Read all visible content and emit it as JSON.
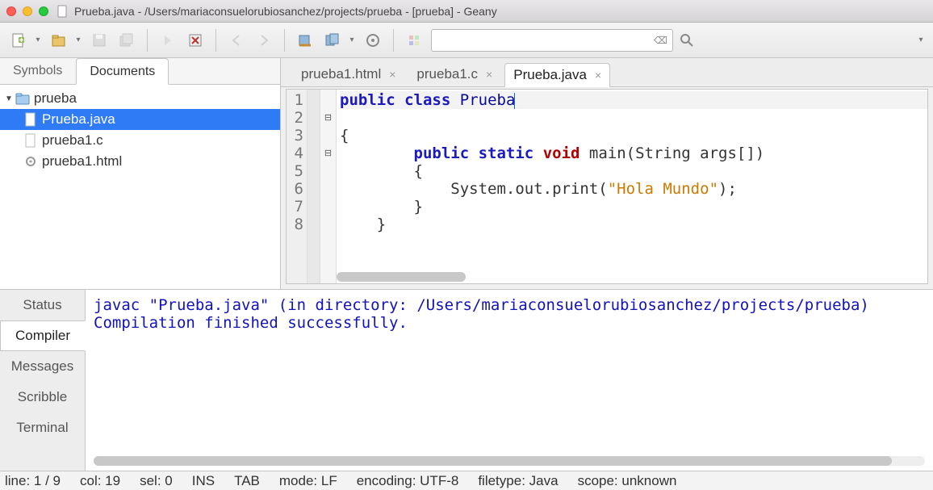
{
  "window": {
    "title": "Prueba.java - /Users/mariaconsuelorubiosanchez/projects/prueba - [prueba] - Geany"
  },
  "sidebar": {
    "tabs": [
      {
        "label": "Symbols",
        "active": false
      },
      {
        "label": "Documents",
        "active": true
      }
    ],
    "tree": {
      "root": {
        "label": "prueba"
      },
      "items": [
        {
          "label": "Prueba.java",
          "selected": true,
          "icon": "page"
        },
        {
          "label": "prueba1.c",
          "selected": false,
          "icon": "page"
        },
        {
          "label": "prueba1.html",
          "selected": false,
          "icon": "gear"
        }
      ]
    }
  },
  "editor": {
    "tabs": [
      {
        "label": "prueba1.html",
        "active": false
      },
      {
        "label": "prueba1.c",
        "active": false
      },
      {
        "label": "Prueba.java",
        "active": true
      }
    ],
    "line_numbers": [
      "1",
      "2",
      "3",
      "4",
      "5",
      "6",
      "7",
      "8"
    ],
    "fold_markers": [
      "",
      "⊟",
      "",
      "⊟",
      "",
      "",
      "",
      ""
    ],
    "code_html": "<span class='hl-line'><span class='kw'>public</span> <span class='kw'>class</span> <span class='cls'>Prueba</span><span class='cursor'></span></span>\n{\n        <span class='kw'>public</span> <span class='kw'>static</span> <span class='kw2'>void</span> main(String args[])\n        {\n            System.out.print(<span class='str'>\"Hola Mundo\"</span>);\n        }\n    }\n"
  },
  "messages": {
    "tabs": [
      {
        "label": "Status",
        "active": false
      },
      {
        "label": "Compiler",
        "active": true
      },
      {
        "label": "Messages",
        "active": false
      },
      {
        "label": "Scribble",
        "active": false
      },
      {
        "label": "Terminal",
        "active": false
      }
    ],
    "lines": [
      "javac \"Prueba.java\" (in directory: /Users/mariaconsuelorubiosanchez/projects/prueba)",
      "Compilation finished successfully."
    ]
  },
  "statusbar": {
    "line": "line: 1 / 9",
    "col": "col: 19",
    "sel": "sel: 0",
    "ins": "INS",
    "tab": "TAB",
    "mode": "mode: LF",
    "encoding": "encoding: UTF-8",
    "filetype": "filetype: Java",
    "scope": "scope: unknown"
  },
  "search": {
    "placeholder": ""
  }
}
